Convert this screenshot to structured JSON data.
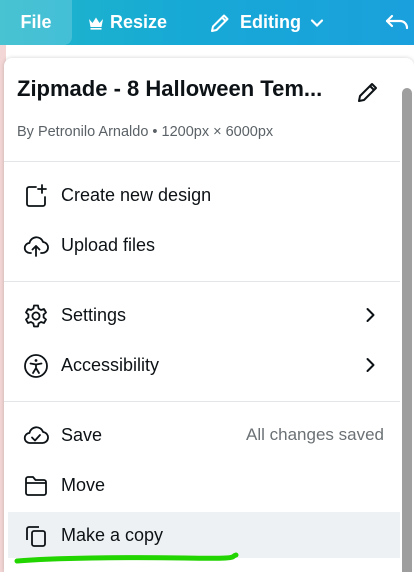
{
  "toolbar": {
    "file_label": "File",
    "resize_label": "Resize",
    "editing_label": "Editing",
    "color": "#18acd5"
  },
  "design": {
    "title": "Zipmade - 8 Halloween Tem...",
    "byline": "By Petronilo Arnaldo • 1200px × 6000px"
  },
  "menu": {
    "create": "Create new design",
    "upload": "Upload files",
    "settings": "Settings",
    "accessibility": "Accessibility",
    "save": "Save",
    "save_status": "All changes saved",
    "move": "Move",
    "copy": "Make a copy"
  },
  "icons": {
    "crown": "crown-icon",
    "pencil": "pencil-icon",
    "undo": "undo-icon"
  },
  "highlight_color": "#22d400"
}
